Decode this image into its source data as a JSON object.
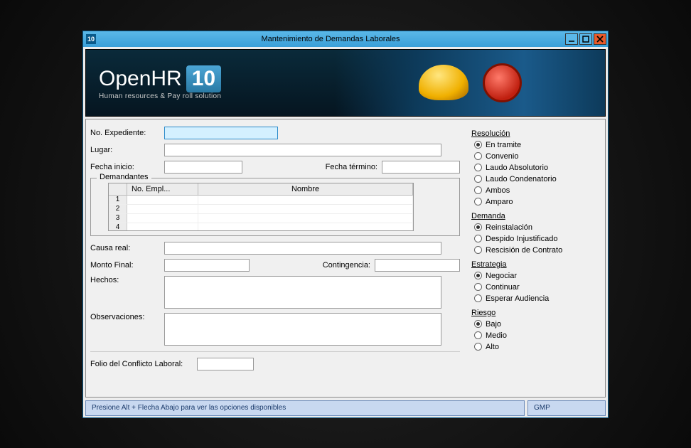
{
  "titlebar": {
    "icon_text": "10",
    "title": "Mantenimiento de Demandas Laborales"
  },
  "logo": {
    "name": "OpenHR",
    "version": "10",
    "tagline": "Human resources & Pay roll solution"
  },
  "labels": {
    "no_expediente": "No. Expediente:",
    "lugar": "Lugar:",
    "fecha_inicio": "Fecha inicio:",
    "fecha_termino": "Fecha término:",
    "demandantes": "Demandantes",
    "col_no_empl": "No. Empl...",
    "col_nombre": "Nombre",
    "causa_real": "Causa real:",
    "monto_final": "Monto Final:",
    "contingencia": "Contingencia:",
    "hechos": "Hechos:",
    "observaciones": "Observaciones:",
    "folio": "Folio del Conflicto Laboral:"
  },
  "values": {
    "no_expediente": "",
    "lugar": "",
    "fecha_inicio": "",
    "fecha_termino": "",
    "causa_real": "",
    "monto_final": "",
    "contingencia": "",
    "hechos": "",
    "observaciones": "",
    "folio": ""
  },
  "grid_rows": [
    "1",
    "2",
    "3",
    "4"
  ],
  "resolucion": {
    "title": "Resolución",
    "selected": 0,
    "options": [
      "En tramite",
      "Convenio",
      "Laudo Absolutorio",
      "Laudo Condenatorio",
      "Ambos",
      "Amparo"
    ]
  },
  "demanda": {
    "title": "Demanda",
    "selected": 0,
    "options": [
      "Reinstalación",
      "Despido Injustificado",
      "Rescisión de Contrato"
    ]
  },
  "estrategia": {
    "title": "Estrategia",
    "selected": 0,
    "options": [
      "Negociar",
      "Continuar",
      "Esperar Audiencia"
    ]
  },
  "riesgo": {
    "title": "Riesgo",
    "selected": 0,
    "options": [
      "Bajo",
      "Medio",
      "Alto"
    ]
  },
  "status": {
    "hint": "Presione Alt + Flecha Abajo para ver las opciones disponibles",
    "user": "GMP"
  }
}
